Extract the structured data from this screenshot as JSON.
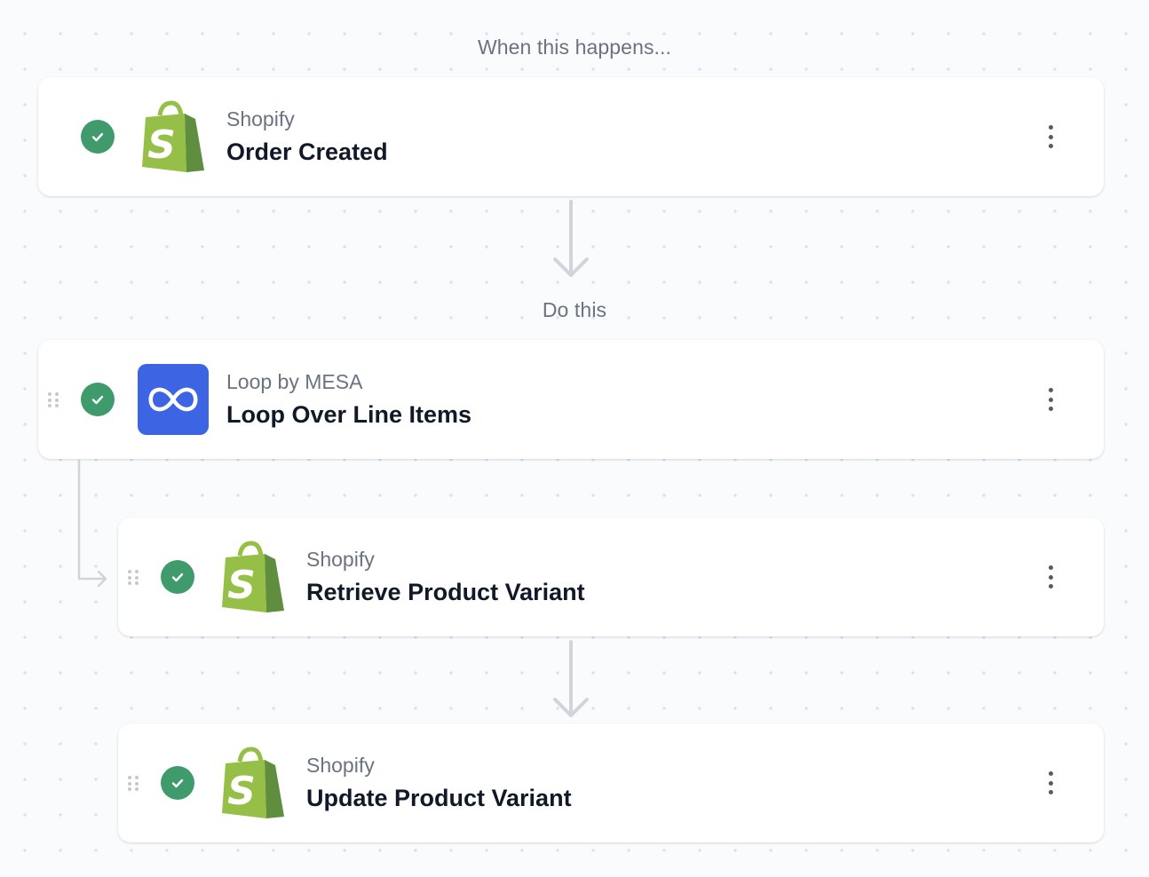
{
  "trigger_label": "When this happens...",
  "action_label": "Do this",
  "steps": [
    {
      "app": "Shopify",
      "action": "Order Created",
      "icon": "shopify-bag-icon",
      "status": "complete"
    },
    {
      "app": "Loop by MESA",
      "action": "Loop Over Line Items",
      "icon": "infinity-loop-icon",
      "status": "complete"
    },
    {
      "app": "Shopify",
      "action": "Retrieve Product Variant",
      "icon": "shopify-bag-icon",
      "status": "complete"
    },
    {
      "app": "Shopify",
      "action": "Update Product Variant",
      "icon": "shopify-bag-icon",
      "status": "complete"
    }
  ],
  "colors": {
    "check": "#3f9b6b",
    "loop_brand": "#3c64e3",
    "shopify_light": "#95bf47",
    "shopify_dark": "#5e8e3e"
  }
}
